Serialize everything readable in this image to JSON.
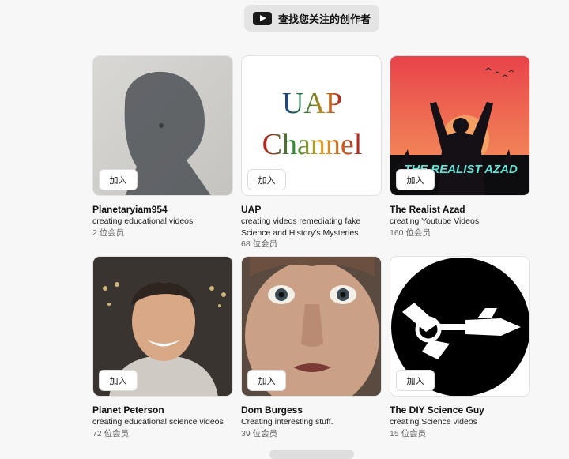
{
  "top_button": {
    "label": "查找您关注的创作者",
    "icon": "youtube-icon"
  },
  "join_label": "加入",
  "creators": [
    {
      "name": "Planetaryiam954",
      "description": "creating educational videos",
      "members": "2 位会员"
    },
    {
      "name": "UAP",
      "description": "creating videos remediating fake Science and History's Mysteries",
      "members": "68 位会员",
      "logo_line1": "UAP",
      "logo_line2": "Channel"
    },
    {
      "name": "The Realist Azad",
      "description": "creating Youtube Videos",
      "members": "160 位会员",
      "logo_text": "THE REALIST AZAD"
    },
    {
      "name": "Planet Peterson",
      "description": "creating educational science videos",
      "members": "72 位会员"
    },
    {
      "name": "Dom Burgess",
      "description": "Creating interesting stuff.",
      "members": "39 位会员"
    },
    {
      "name": "The DIY Science Guy",
      "description": "creating Science videos",
      "members": "15 位会员"
    }
  ]
}
